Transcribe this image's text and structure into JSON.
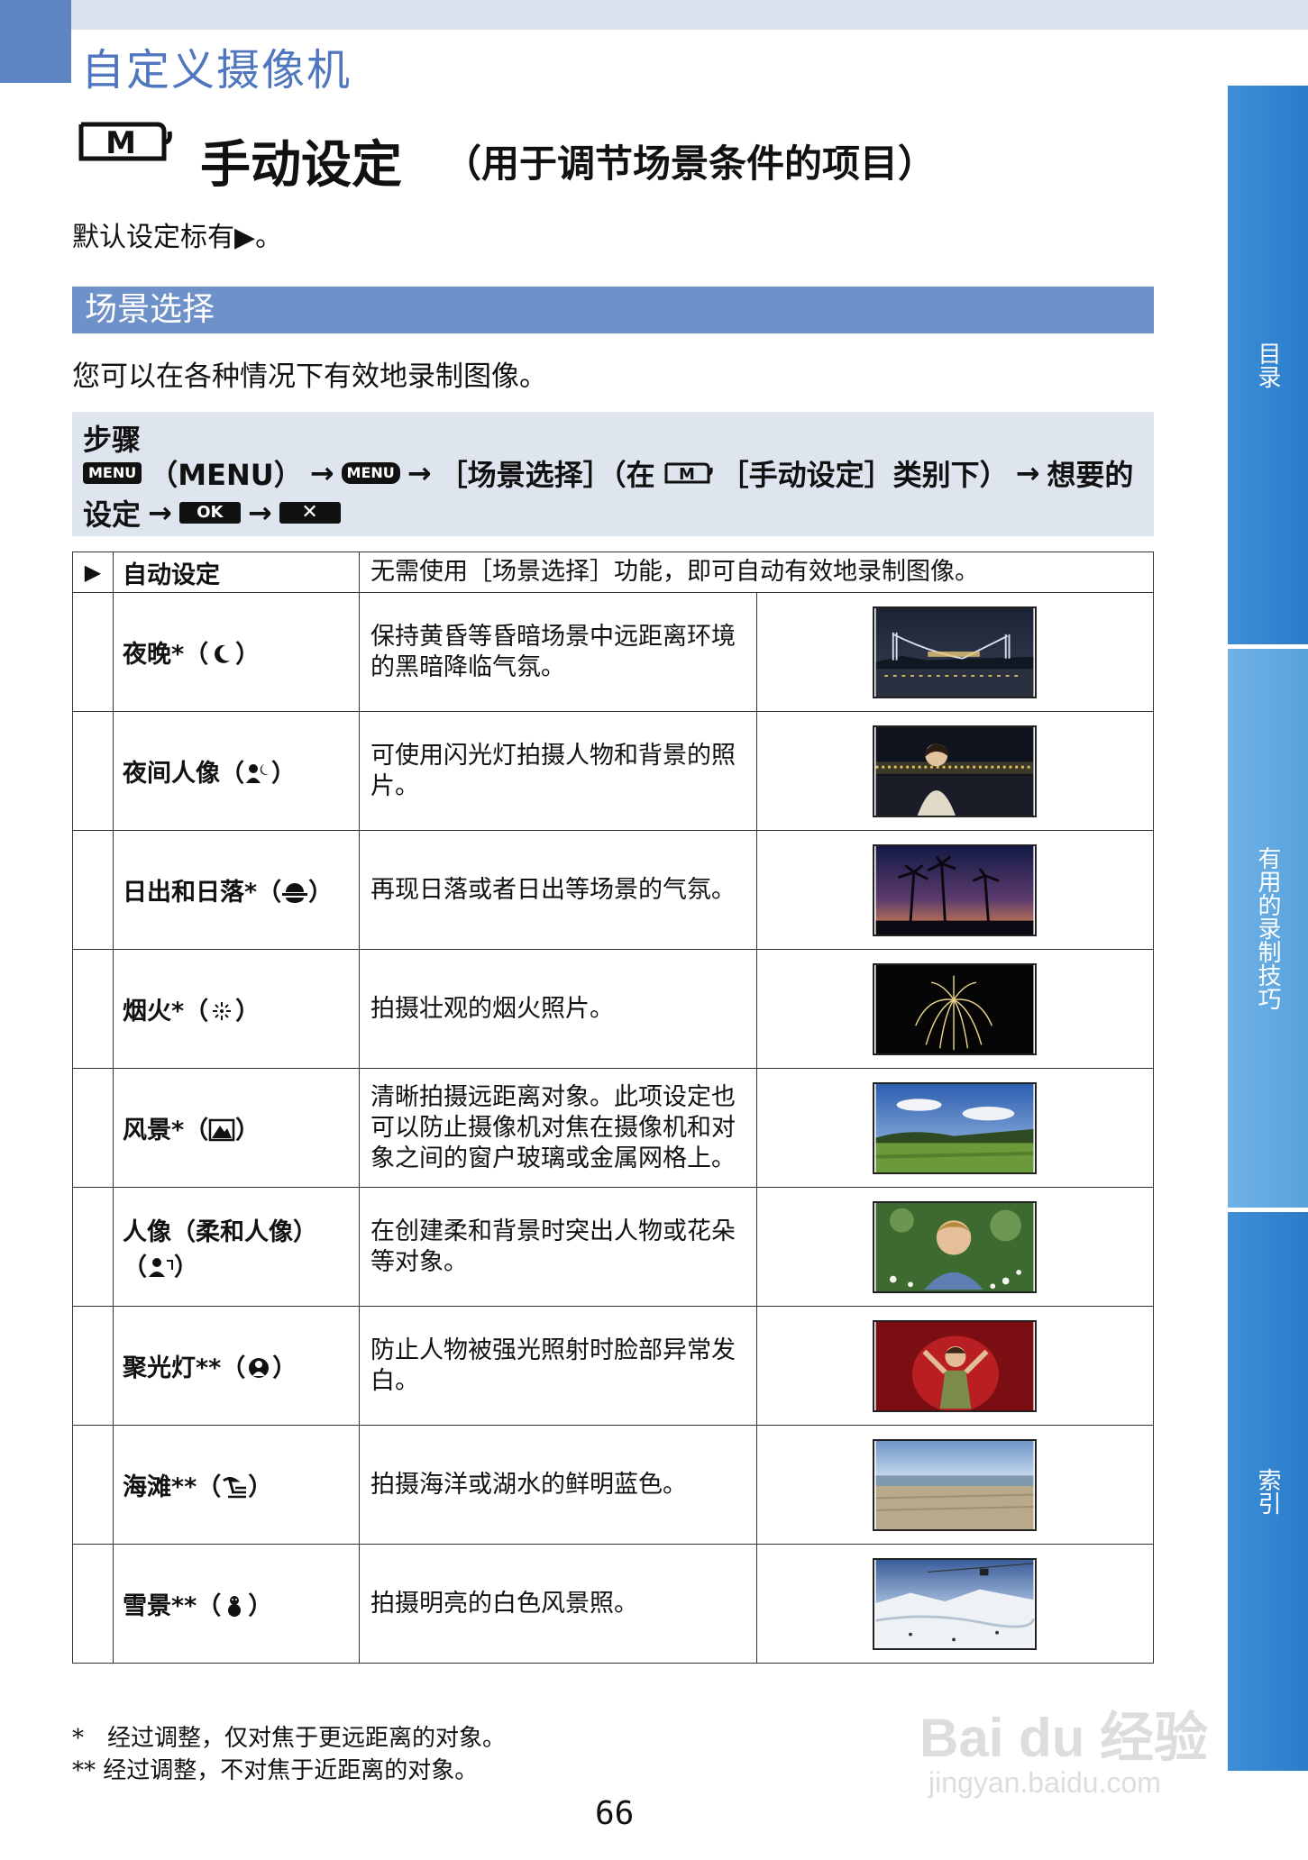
{
  "header": {
    "chapter": "自定义摄像机",
    "mode_letter": "M",
    "title": "手动设定",
    "subtitle": "（用于调节场景条件的项目）"
  },
  "default_note": "默认设定标有▶。",
  "section": {
    "title": "场景选择",
    "intro": "您可以在各种情况下有效地录制图像。"
  },
  "steps": {
    "title": "步骤",
    "menu_btn": "MENU",
    "menu_text": "（MENU）",
    "arrow": "→",
    "menu_btn2": "MENU",
    "seg1": "［场景选择］（在",
    "seg2": "［手动设定］类别下）",
    "seg3": "想要的",
    "seg4": "设定",
    "ok": "OK",
    "close": "✕"
  },
  "table": {
    "rows": [
      {
        "mark": "▶",
        "name": "自动设定",
        "desc": "无需使用［场景选择］功能，即可自动有效地录制图像。"
      },
      {
        "name": "夜晚*（",
        "name_end": "）",
        "icon": "moon-icon",
        "desc": "保持黄昏等昏暗场景中远距离环境的黑暗降临气氛。",
        "thumb": "night-bridge"
      },
      {
        "name": "夜间人像（",
        "name_end": "）",
        "icon": "night-portrait-icon",
        "desc": "可使用闪光灯拍摄人物和背景的照片。",
        "thumb": "night-portrait"
      },
      {
        "name": "日出和日落*（",
        "name_end": "）",
        "icon": "sunset-icon",
        "desc": "再现日落或者日出等场景的气氛。",
        "thumb": "sunset-palms"
      },
      {
        "name": "烟火*（",
        "name_end": "）",
        "icon": "fireworks-icon",
        "desc": "拍摄壮观的烟火照片。",
        "thumb": "fireworks"
      },
      {
        "name": "风景*（",
        "name_end": "）",
        "icon": "landscape-icon",
        "desc": "清晰拍摄远距离对象。此项设定也可以防止摄像机对焦在摄像机和对象之间的窗户玻璃或金属网格上。",
        "thumb": "landscape"
      },
      {
        "name": "人像（柔和人像）",
        "name2": "（",
        "name_end": "）",
        "icon": "portrait-icon",
        "desc": "在创建柔和背景时突出人物或花朵等对象。",
        "thumb": "portrait"
      },
      {
        "name": "聚光灯**（",
        "name_end": "）",
        "icon": "spotlight-icon",
        "desc": "防止人物被强光照射时脸部异常发白。",
        "thumb": "spotlight"
      },
      {
        "name": "海滩**（",
        "name_end": "）",
        "icon": "beach-icon",
        "desc": "拍摄海洋或湖水的鲜明蓝色。",
        "thumb": "beach"
      },
      {
        "name": "雪景**（",
        "name_end": "）",
        "icon": "snow-icon",
        "desc": "拍摄明亮的白色风景照。",
        "thumb": "snow"
      }
    ]
  },
  "footnotes": [
    "*　经过调整，仅对焦于更远距离的对象。",
    "**  经过调整，不对焦于近距离的对象。"
  ],
  "page_number": "66",
  "side_tabs": [
    "目录",
    "有用的录制技巧",
    "索引"
  ],
  "watermark": {
    "text": "Bai du 经验",
    "url": "jingyan.baidu.com"
  }
}
